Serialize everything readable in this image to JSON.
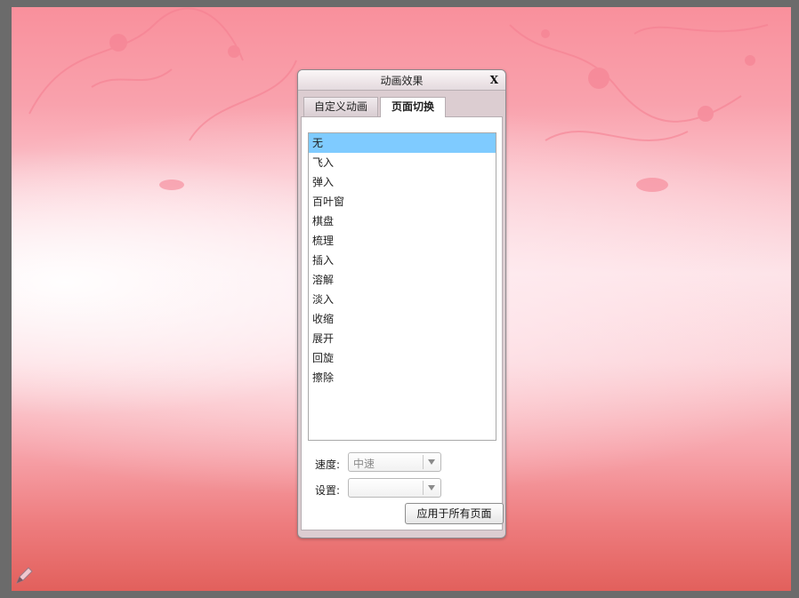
{
  "dialog": {
    "title": "动画效果",
    "close_label": "X",
    "tabs": [
      {
        "label": "自定义动画",
        "active": false
      },
      {
        "label": "页面切换",
        "active": true
      }
    ],
    "transitions": [
      {
        "label": "无",
        "selected": true
      },
      {
        "label": "飞入",
        "selected": false
      },
      {
        "label": "弹入",
        "selected": false
      },
      {
        "label": "百叶窗",
        "selected": false
      },
      {
        "label": "棋盘",
        "selected": false
      },
      {
        "label": "梳理",
        "selected": false
      },
      {
        "label": "插入",
        "selected": false
      },
      {
        "label": "溶解",
        "selected": false
      },
      {
        "label": "淡入",
        "selected": false
      },
      {
        "label": "收缩",
        "selected": false
      },
      {
        "label": "展开",
        "selected": false
      },
      {
        "label": "回旋",
        "selected": false
      },
      {
        "label": "擦除",
        "selected": false
      }
    ],
    "speed": {
      "label": "速度:",
      "value": "中速"
    },
    "settings": {
      "label": "设置:",
      "value": ""
    },
    "apply_all_label": "应用于所有页面"
  },
  "icons": {
    "pen": "pen-icon",
    "dropdown": "chevron-down-icon"
  },
  "colors": {
    "selection": "#7fcbff",
    "slide_top": "#f9909c",
    "slide_bottom": "#e2605c"
  }
}
